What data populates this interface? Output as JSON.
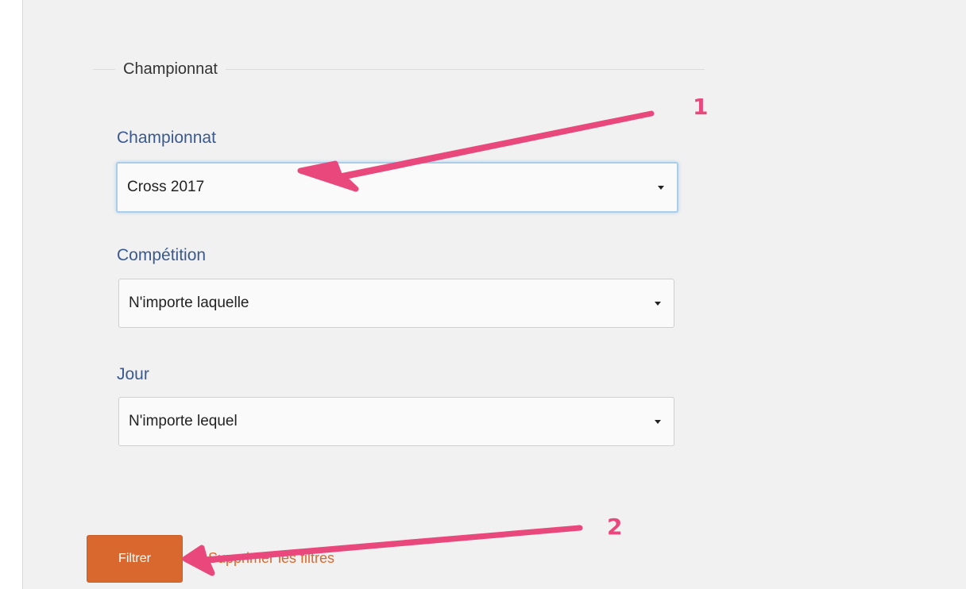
{
  "fieldset": {
    "legend": "Championnat"
  },
  "fields": [
    {
      "label": "Championnat",
      "value": "Cross 2017"
    },
    {
      "label": "Compétition",
      "value": "N'importe laquelle"
    },
    {
      "label": "Jour",
      "value": "N'importe lequel"
    }
  ],
  "actions": {
    "filter_label": "Filtrer",
    "reset_label": "Supprimer les filtres"
  },
  "annotations": {
    "first_number": "1",
    "second_number": "2",
    "arrow_color": "#e9487d"
  },
  "colors": {
    "panel_background": "#f1f1f1",
    "label_color": "#3a5a8f",
    "button_color": "#d9682f"
  }
}
